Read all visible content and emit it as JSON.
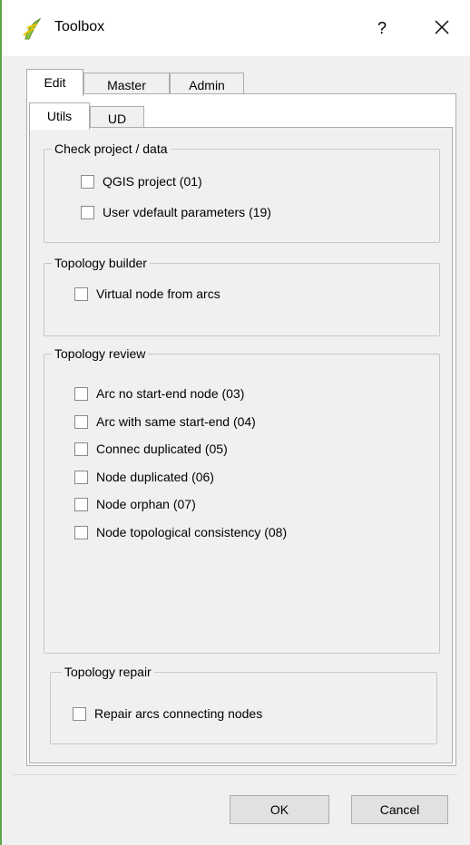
{
  "window": {
    "title": "Toolbox",
    "help_label": "?",
    "close_icon": "close-icon",
    "app_icon": "qgis-icon"
  },
  "outer_tabs": [
    {
      "label": "Edit",
      "active": true
    },
    {
      "label": "Master",
      "active": false
    },
    {
      "label": "Admin",
      "active": false
    }
  ],
  "inner_tabs": [
    {
      "label": "Utils",
      "active": true
    },
    {
      "label": "UD",
      "active": false
    }
  ],
  "groups": {
    "check": {
      "title": "Check project / data",
      "items": [
        {
          "label": "QGIS project (01)",
          "checked": false
        },
        {
          "label": "User vdefault parameters (19)",
          "checked": false
        }
      ]
    },
    "builder": {
      "title": "Topology builder",
      "items": [
        {
          "label": "Virtual node from arcs",
          "checked": false
        }
      ]
    },
    "review": {
      "title": "Topology review",
      "items": [
        {
          "label": "Arc no start-end node (03)",
          "checked": false
        },
        {
          "label": "Arc with same start-end (04)",
          "checked": false
        },
        {
          "label": "Connec duplicated (05)",
          "checked": false
        },
        {
          "label": "Node duplicated (06)",
          "checked": false
        },
        {
          "label": "Node orphan (07)",
          "checked": false
        },
        {
          "label": "Node topological consistency (08)",
          "checked": false
        }
      ]
    },
    "repair": {
      "title": "Topology repair",
      "items": [
        {
          "label": "Repair arcs connecting nodes",
          "checked": false
        }
      ]
    }
  },
  "buttons": {
    "ok": "OK",
    "cancel": "Cancel"
  },
  "colors": {
    "accent_border": "#5aa64a",
    "dialog_bg": "#f0f0f0"
  }
}
